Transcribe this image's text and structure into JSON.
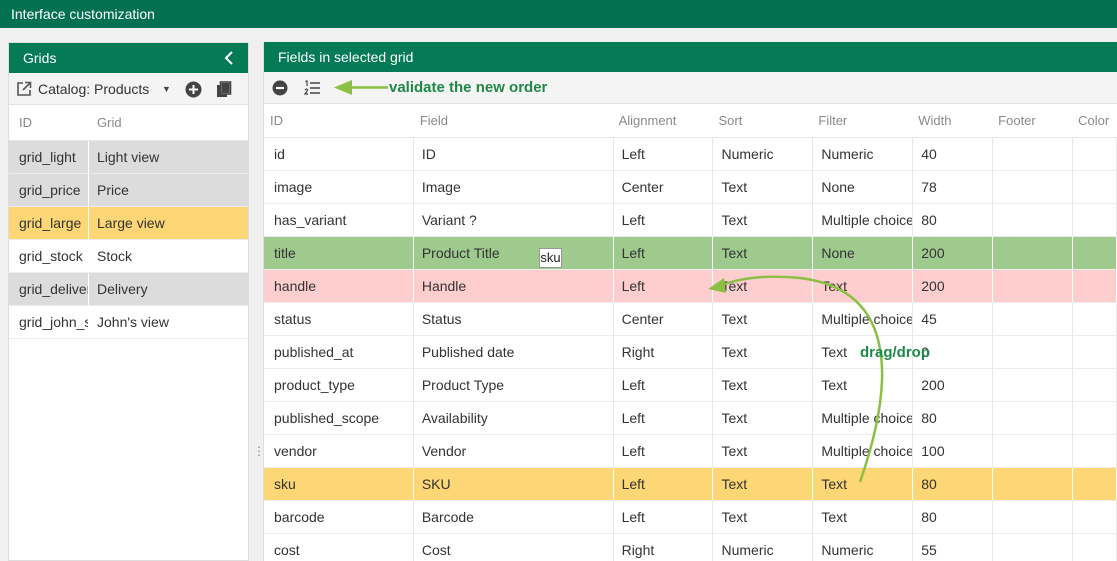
{
  "window": {
    "title": "Interface customization"
  },
  "left_panel": {
    "title": "Grids",
    "catalog_label": "Catalog: Products",
    "columns": {
      "id": "ID",
      "grid": "Grid"
    },
    "rows": [
      {
        "id": "grid_light",
        "grid": "Light view",
        "state": "grey"
      },
      {
        "id": "grid_price",
        "grid": "Price",
        "state": "grey"
      },
      {
        "id": "grid_large",
        "grid": "Large view",
        "state": "yellow"
      },
      {
        "id": "grid_stock",
        "grid": "Stock",
        "state": ""
      },
      {
        "id": "grid_delivery",
        "grid": "Delivery",
        "state": "grey"
      },
      {
        "id": "grid_john_s",
        "grid": "John's view",
        "state": ""
      }
    ]
  },
  "right_panel": {
    "title": "Fields in selected grid",
    "annotation_validate": "validate the new order",
    "annotation_drag": "drag/drop",
    "drag_ghost": "sku",
    "columns": {
      "id": "ID",
      "field": "Field",
      "alignment": "Alignment",
      "sort": "Sort",
      "filter": "Filter",
      "width": "Width",
      "footer": "Footer",
      "color": "Color"
    },
    "rows": [
      {
        "id": "id",
        "field": "ID",
        "alignment": "Left",
        "sort": "Numeric",
        "filter": "Numeric",
        "width": "40",
        "state": ""
      },
      {
        "id": "image",
        "field": "Image",
        "alignment": "Center",
        "sort": "Text",
        "filter": "None",
        "width": "78",
        "state": ""
      },
      {
        "id": "has_variant",
        "field": "Variant ?",
        "alignment": "Left",
        "sort": "Text",
        "filter": "Multiple choice",
        "width": "80",
        "state": ""
      },
      {
        "id": "title",
        "field": "Product Title",
        "alignment": "Left",
        "sort": "Text",
        "filter": "None",
        "width": "200",
        "state": "green"
      },
      {
        "id": "handle",
        "field": "Handle",
        "alignment": "Left",
        "sort": "Text",
        "filter": "Text",
        "width": "200",
        "state": "pink"
      },
      {
        "id": "status",
        "field": "Status",
        "alignment": "Center",
        "sort": "Text",
        "filter": "Multiple choice",
        "width": "45",
        "state": ""
      },
      {
        "id": "published_at",
        "field": "Published date",
        "alignment": "Right",
        "sort": "Text",
        "filter": "Text",
        "width": "0",
        "state": ""
      },
      {
        "id": "product_type",
        "field": "Product Type",
        "alignment": "Left",
        "sort": "Text",
        "filter": "Text",
        "width": "200",
        "state": ""
      },
      {
        "id": "published_scope",
        "field": "Availability",
        "alignment": "Left",
        "sort": "Text",
        "filter": "Multiple choice",
        "width": "80",
        "state": ""
      },
      {
        "id": "vendor",
        "field": "Vendor",
        "alignment": "Left",
        "sort": "Text",
        "filter": "Multiple choice",
        "width": "100",
        "state": ""
      },
      {
        "id": "sku",
        "field": "SKU",
        "alignment": "Left",
        "sort": "Text",
        "filter": "Text",
        "width": "80",
        "state": "yellow"
      },
      {
        "id": "barcode",
        "field": "Barcode",
        "alignment": "Left",
        "sort": "Text",
        "filter": "Text",
        "width": "80",
        "state": ""
      },
      {
        "id": "cost",
        "field": "Cost",
        "alignment": "Right",
        "sort": "Numeric",
        "filter": "Numeric",
        "width": "55",
        "state": ""
      }
    ]
  },
  "icons": {
    "external_edit": "external-link-icon",
    "add": "plus-circle-icon",
    "copy": "copy-icon",
    "remove": "minus-circle-icon",
    "order": "ordered-list-icon",
    "collapse": "chevron-left-icon"
  },
  "colors": {
    "header_green": "#03704f",
    "panel_green": "#047a55",
    "selected_yellow": "#fdd675",
    "grey_row": "#dcdcdc",
    "green_row": "#9eca8e",
    "pink_row": "#fecdcd",
    "annotation_green": "#1f8a47",
    "arrow_green": "#8cbf45"
  }
}
